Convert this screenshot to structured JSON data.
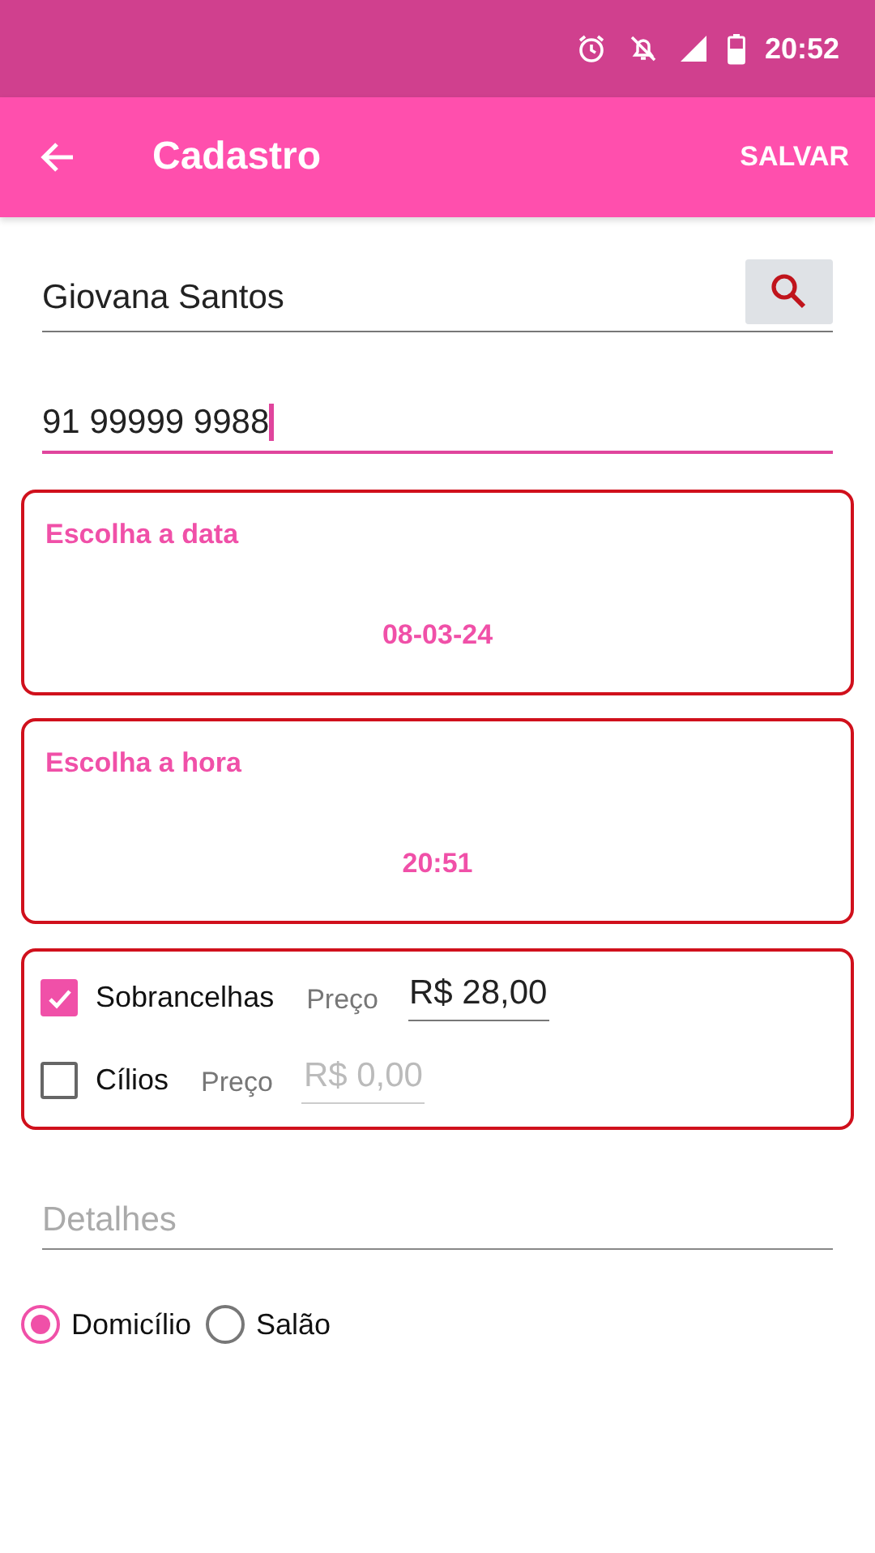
{
  "status_bar": {
    "time": "20:52"
  },
  "app_bar": {
    "title": "Cadastro",
    "action": "SALVAR"
  },
  "name_field": {
    "value": "Giovana Santos",
    "focused": false
  },
  "phone_field": {
    "value": "91 99999 9988",
    "focused": true
  },
  "pickers": [
    {
      "label": "Escolha a data",
      "value": "08-03-24"
    },
    {
      "label": "Escolha a hora",
      "value": "20:51"
    }
  ],
  "services": [
    {
      "label": "Sobrancelhas",
      "checked": true,
      "price_label": "Preço",
      "price_value": "R$ 28,00"
    },
    {
      "label": "Cílios",
      "checked": false,
      "price_label": "Preço",
      "price_placeholder": "R$ 0,00"
    }
  ],
  "details_field": {
    "placeholder": "Detalhes"
  },
  "location": [
    {
      "label": "Domicílio",
      "selected": true
    },
    {
      "label": "Salão",
      "selected": false
    }
  ]
}
